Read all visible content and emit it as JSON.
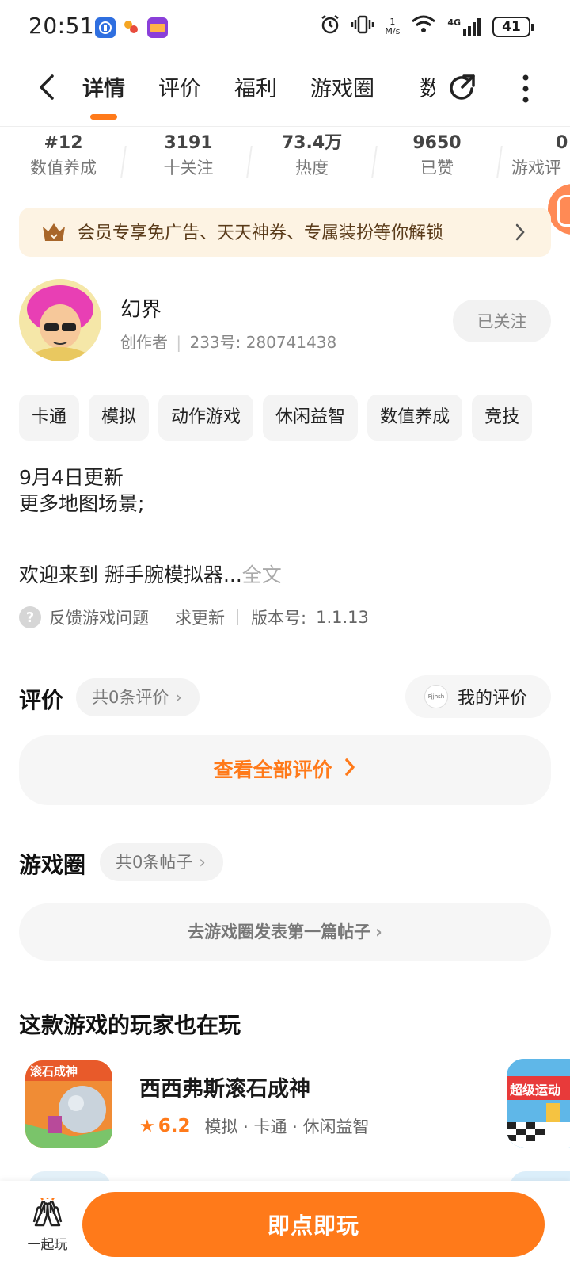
{
  "status_bar": {
    "time": "20:51",
    "speed_value": "1",
    "speed_unit": "M/s",
    "network": "4G",
    "battery": "41"
  },
  "nav": {
    "tabs": [
      {
        "label": "详情",
        "active": true
      },
      {
        "label": "评价",
        "active": false
      },
      {
        "label": "福利",
        "active": false
      },
      {
        "label": "游戏圈",
        "active": false
      }
    ],
    "clipped_tab": "数",
    "accent_color": "#ff7a1a"
  },
  "stats": [
    {
      "value": "#12",
      "label": "数值养成"
    },
    {
      "value": "3191",
      "label": "十关注"
    },
    {
      "value": "73.4万",
      "label": "热度"
    },
    {
      "value": "9650",
      "label": "已赞"
    },
    {
      "value": "0",
      "label": "游戏评"
    }
  ],
  "vip_banner": {
    "text": "会员专享免广告、天天神券、专属装扮等你解锁"
  },
  "creator": {
    "name": "幻界",
    "role": "创作者",
    "id_text": "233号: 280741438",
    "follow_label": "已关注"
  },
  "tags": [
    "卡通",
    "模拟",
    "动作游戏",
    "休闲益智",
    "数值养成",
    "竞技"
  ],
  "description": {
    "line1": "9月4日更新",
    "line2": "更多地图场景;",
    "line3": "欢迎来到 掰手腕模拟器...",
    "more": "全文"
  },
  "info": {
    "feedback": "反馈游戏问题",
    "request_update": "求更新",
    "version_label": "版本号:",
    "version": "1.1.13"
  },
  "reviews": {
    "title": "评价",
    "count_text": "共0条评价",
    "my_review": "我的评价",
    "view_all": "查看全部评价"
  },
  "game_circle": {
    "title": "游戏圈",
    "count_text": "共0条帖子",
    "post_first": "去游戏圈发表第一篇帖子"
  },
  "recommend": {
    "title": "这款游戏的玩家也在玩",
    "games": [
      {
        "name": "西西弗斯滚石成神",
        "icon_text": "滚石成神",
        "rating": "6.2",
        "tags": "模拟 · 卡通 · 休闲益智"
      },
      {
        "icon_text": "超级运动"
      }
    ]
  },
  "bottom": {
    "together_label": "一起玩",
    "play_label": "即点即玩"
  }
}
